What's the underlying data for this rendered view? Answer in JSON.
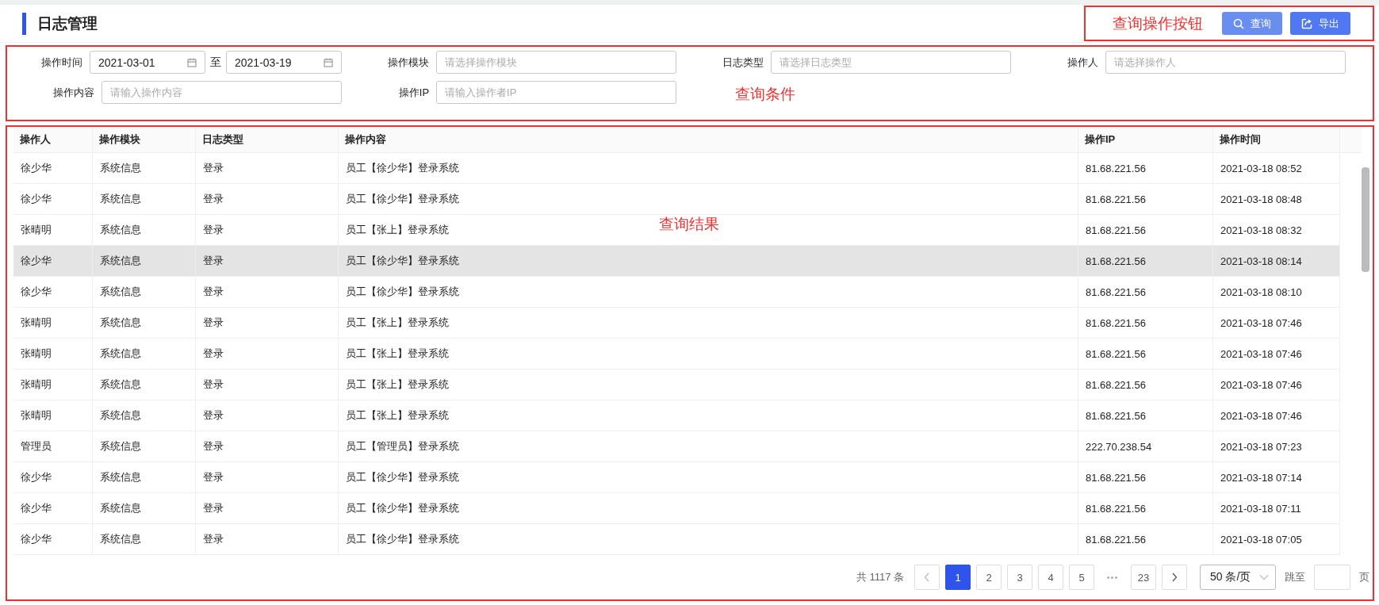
{
  "page": {
    "title": "日志管理"
  },
  "annotations": [
    {
      "kind": "buttons",
      "label": "查询操作按钮"
    },
    {
      "kind": "filters",
      "label": "查询条件"
    },
    {
      "kind": "results",
      "label": "查询结果"
    }
  ],
  "actions": [
    {
      "kind": "search",
      "label": "查询"
    },
    {
      "kind": "export",
      "label": "导出"
    }
  ],
  "filters": [
    {
      "kind": "date_range",
      "label": "操作时间",
      "start": "2021-03-01",
      "separator": "至",
      "end": "2021-03-19"
    },
    {
      "kind": "select",
      "label": "操作模块",
      "placeholder": "请选择操作模块"
    },
    {
      "kind": "select",
      "label": "日志类型",
      "placeholder": "请选择日志类型"
    },
    {
      "kind": "select",
      "label": "操作人",
      "placeholder": "请选择操作人"
    },
    {
      "kind": "input",
      "label": "操作内容",
      "placeholder": "请输入操作内容"
    },
    {
      "kind": "input",
      "label": "操作IP",
      "placeholder": "请输入操作者IP"
    }
  ],
  "table": {
    "columns": [
      "操作人",
      "操作模块",
      "日志类型",
      "操作内容",
      "操作IP",
      "操作时间"
    ],
    "rows": [
      {
        "highlighted": false,
        "cells": [
          "徐少华",
          "系统信息",
          "登录",
          "员工【徐少华】登录系统",
          "81.68.221.56",
          "2021-03-18 08:52"
        ]
      },
      {
        "highlighted": false,
        "cells": [
          "徐少华",
          "系统信息",
          "登录",
          "员工【徐少华】登录系统",
          "81.68.221.56",
          "2021-03-18 08:48"
        ]
      },
      {
        "highlighted": false,
        "cells": [
          "张晴明",
          "系统信息",
          "登录",
          "员工【张上】登录系统",
          "81.68.221.56",
          "2021-03-18 08:32"
        ]
      },
      {
        "highlighted": true,
        "cells": [
          "徐少华",
          "系统信息",
          "登录",
          "员工【徐少华】登录系统",
          "81.68.221.56",
          "2021-03-18 08:14"
        ]
      },
      {
        "highlighted": false,
        "cells": [
          "徐少华",
          "系统信息",
          "登录",
          "员工【徐少华】登录系统",
          "81.68.221.56",
          "2021-03-18 08:10"
        ]
      },
      {
        "highlighted": false,
        "cells": [
          "张晴明",
          "系统信息",
          "登录",
          "员工【张上】登录系统",
          "81.68.221.56",
          "2021-03-18 07:46"
        ]
      },
      {
        "highlighted": false,
        "cells": [
          "张晴明",
          "系统信息",
          "登录",
          "员工【张上】登录系统",
          "81.68.221.56",
          "2021-03-18 07:46"
        ]
      },
      {
        "highlighted": false,
        "cells": [
          "张晴明",
          "系统信息",
          "登录",
          "员工【张上】登录系统",
          "81.68.221.56",
          "2021-03-18 07:46"
        ]
      },
      {
        "highlighted": false,
        "cells": [
          "张晴明",
          "系统信息",
          "登录",
          "员工【张上】登录系统",
          "81.68.221.56",
          "2021-03-18 07:46"
        ]
      },
      {
        "highlighted": false,
        "cells": [
          "管理员",
          "系统信息",
          "登录",
          "员工【管理员】登录系统",
          "222.70.238.54",
          "2021-03-18 07:23"
        ]
      },
      {
        "highlighted": false,
        "cells": [
          "徐少华",
          "系统信息",
          "登录",
          "员工【徐少华】登录系统",
          "81.68.221.56",
          "2021-03-18 07:14"
        ]
      },
      {
        "highlighted": false,
        "cells": [
          "徐少华",
          "系统信息",
          "登录",
          "员工【徐少华】登录系统",
          "81.68.221.56",
          "2021-03-18 07:11"
        ]
      },
      {
        "highlighted": false,
        "cells": [
          "徐少华",
          "系统信息",
          "登录",
          "员工【徐少华】登录系统",
          "81.68.221.56",
          "2021-03-18 07:05"
        ]
      }
    ]
  },
  "pagination": {
    "total": "共 1117 条",
    "pages": [
      {
        "kind": "page",
        "label": "1",
        "selected": true
      },
      {
        "kind": "page",
        "label": "2",
        "selected": false
      },
      {
        "kind": "page",
        "label": "3",
        "selected": false
      },
      {
        "kind": "page",
        "label": "4",
        "selected": false
      },
      {
        "kind": "page",
        "label": "5",
        "selected": false
      },
      {
        "kind": "ellipsis",
        "label": "•••",
        "selected": false
      },
      {
        "kind": "page",
        "label": "23",
        "selected": false
      }
    ],
    "page_size": "50 条/页",
    "jump_label": "跳至",
    "page_suffix": "页"
  }
}
